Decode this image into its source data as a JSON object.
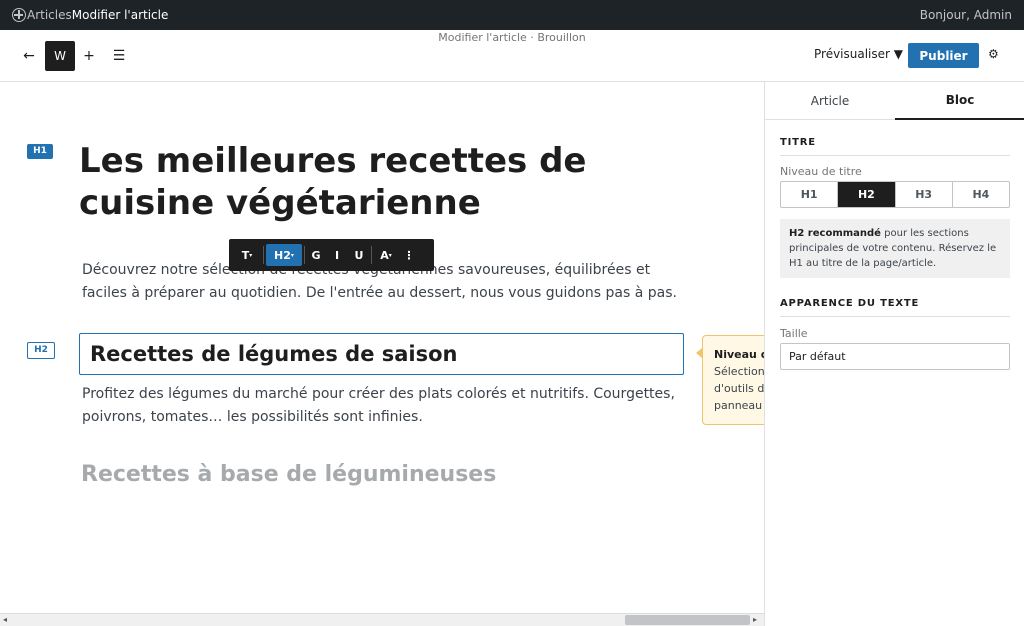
{
  "adminbar": {
    "crumbs": [
      "Articles",
      "Modifier l'article"
    ],
    "greeting": "Bonjour, Admin"
  },
  "header": {
    "doc_title": "Modifier l'article · Brouillon",
    "back": "←",
    "logo": "W",
    "add": "+",
    "list": "☰",
    "preview": "Prévisualiser ▼",
    "publish": "Publier",
    "settings": "⚙"
  },
  "canvas": {
    "h1_tag": "H1",
    "h1_title": "Les meilleures recettes de cuisine végétarienne",
    "p1": "Découvrez notre sélection de recettes végétariennes savoureuses, équilibrées et faciles à préparer au quotidien. De l'entrée au dessert, nous vous guidons pas à pas.",
    "h2_tag": "H2",
    "h2_title": "Recettes de légumes de saison",
    "p2": "Profitez des légumes du marché pour créer des plats colorés et nutritifs. Courgettes, poivrons, tomates… les possibilités sont infinies.",
    "h2_next": "Recettes à base de légumineuses"
  },
  "block_toolbar": {
    "transform": "T",
    "heading": "H2",
    "bold": "G",
    "italic": "I",
    "underline": "U",
    "color": "A",
    "more": "⋮"
  },
  "tooltip": {
    "title": "Niveau d",
    "line1": "Sélection",
    "line2": "d'outils d",
    "line3": "panneau"
  },
  "sidebar": {
    "tabs": [
      "Article",
      "Bloc"
    ],
    "active_tab": "Bloc",
    "title_section": "TITRE",
    "level_label": "Niveau de titre",
    "levels": [
      "H1",
      "H2",
      "H3",
      "H4"
    ],
    "selected_level": "H2",
    "notice_bold": "H2 recommandé",
    "notice_text": " pour les sections principales de votre contenu. Réservez le H1 au titre de la page/article.",
    "appearance_section": "APPARENCE DU TEXTE",
    "size_label": "Taille",
    "size_value": "Par défaut"
  },
  "colors": {
    "accent": "#2271b1",
    "adminbar": "#1d2327",
    "tooltip_bg": "#fff8e5"
  }
}
